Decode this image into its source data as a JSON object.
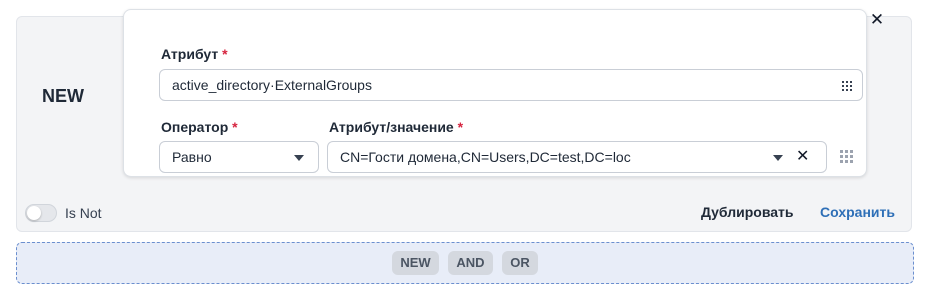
{
  "rule": {
    "node_label": "NEW",
    "attribute": {
      "label": "Атрибут",
      "required_mark": "*",
      "value": "active_directory·ExternalGroups",
      "icon": "grid-dots-icon"
    },
    "operator": {
      "label": "Оператор",
      "required_mark": "*",
      "value": "Равно",
      "icon": "chevron-down-icon"
    },
    "attr_value": {
      "label": "Атрибут/значение",
      "required_mark": "*",
      "value": "CN=Гости домена,CN=Users,DC=test,DC=loc",
      "icons": [
        "chevron-down-icon",
        "clear-icon",
        "grid-dots-icon"
      ]
    },
    "close_icon": "close-icon",
    "is_not": {
      "label": "Is Not",
      "checked": false
    },
    "actions": {
      "duplicate": "Дублировать",
      "save": "Сохранить"
    },
    "colors": {
      "required": "#d6243f",
      "save_link": "#2e6fb7",
      "dropzone_border": "#6b8fcf"
    }
  },
  "dropzone": {
    "chips": [
      "NEW",
      "AND",
      "OR"
    ]
  }
}
